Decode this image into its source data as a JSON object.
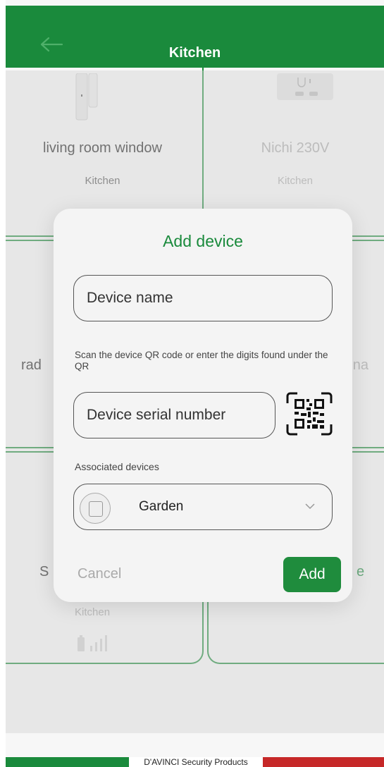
{
  "header": {
    "title": "Kitchen"
  },
  "cards": [
    {
      "name": "living room window",
      "room": "Kitchen"
    },
    {
      "name": "Nichi 230V",
      "room": "Kitchen"
    },
    {
      "name": "rad",
      "room": ""
    },
    {
      "name": "na",
      "room": ""
    },
    {
      "name": "S",
      "room": "Kitchen"
    },
    {
      "name": "e",
      "room": ""
    }
  ],
  "modal": {
    "title": "Add device",
    "device_name_placeholder": "Device name",
    "hint": "Scan the device QR code or enter the digits found under the QR",
    "serial_placeholder": "Device serial number",
    "associated_label": "Associated devices",
    "associated_value": "Garden",
    "cancel_label": "Cancel",
    "add_label": "Add"
  },
  "footer": {
    "brand": "D'AVINCI Security Products"
  },
  "colors": {
    "brand_green": "#1a8a3c",
    "brand_red": "#c62828"
  }
}
